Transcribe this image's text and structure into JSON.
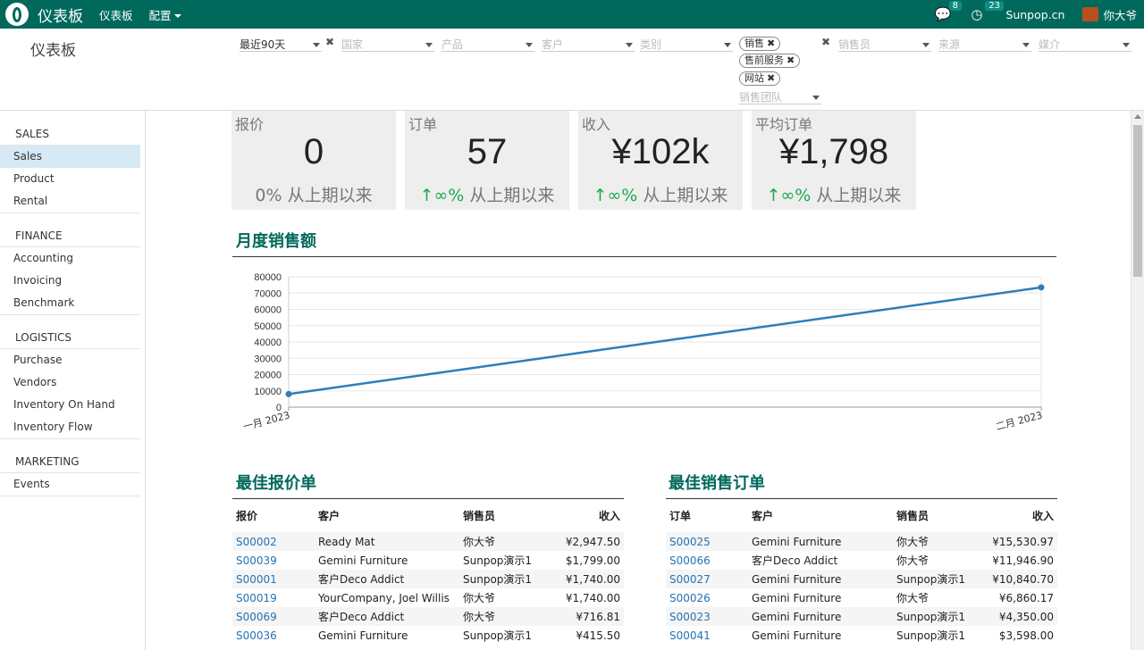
{
  "navbar": {
    "app_name": "仪表板",
    "menu_dashboard": "仪表板",
    "menu_config": "配置",
    "messages_count": "8",
    "activities_count": "23",
    "company": "Sunpop.cn",
    "user": "你大爷"
  },
  "control": {
    "title": "仪表板",
    "date_filter": "最近90天",
    "country_placeholder": "国家",
    "product_placeholder": "产品",
    "customer_placeholder": "客户",
    "category_placeholder": "类别",
    "team_chips": [
      "销售",
      "售前服务",
      "网站"
    ],
    "sales_team_placeholder": "销售团队",
    "salesperson_placeholder": "销售员",
    "source_placeholder": "来源",
    "medium_placeholder": "媒介"
  },
  "sidebar": {
    "sections": [
      {
        "title": "SALES",
        "items": [
          "Sales",
          "Product",
          "Rental"
        ]
      },
      {
        "title": "FINANCE",
        "items": [
          "Accounting",
          "Invoicing",
          "Benchmark"
        ]
      },
      {
        "title": "LOGISTICS",
        "items": [
          "Purchase",
          "Vendors",
          "Inventory On Hand",
          "Inventory Flow"
        ]
      },
      {
        "title": "MARKETING",
        "items": [
          "Events"
        ]
      }
    ]
  },
  "kpis": [
    {
      "label": "报价",
      "value": "0",
      "trend_arrow": "",
      "trend_value": "0%",
      "trend_text": "从上期以来"
    },
    {
      "label": "订单",
      "value": "57",
      "trend_arrow": "↑",
      "trend_value": "∞%",
      "trend_text": "从上期以来"
    },
    {
      "label": "收入",
      "value": "¥102k",
      "trend_arrow": "↑",
      "trend_value": "∞%",
      "trend_text": "从上期以来"
    },
    {
      "label": "平均订单",
      "value": "¥1,798",
      "trend_arrow": "↑",
      "trend_value": "∞%",
      "trend_text": "从上期以来"
    }
  ],
  "monthly_sales": {
    "title": "月度销售额"
  },
  "chart_data": {
    "type": "line",
    "title": "月度销售额",
    "x": [
      "一月 2023",
      "二月 2023"
    ],
    "series": [
      {
        "values": [
          8000,
          73500
        ]
      }
    ],
    "yticks": [
      0,
      10000,
      20000,
      30000,
      40000,
      50000,
      60000,
      70000,
      80000
    ],
    "ylim": [
      0,
      80000
    ],
    "grid": true,
    "color": "#2e7db8"
  },
  "best_quotations": {
    "title": "最佳报价单",
    "headers": [
      "报价",
      "客户",
      "销售员",
      "收入"
    ],
    "rows": [
      [
        "S00002",
        "Ready Mat",
        "你大爷",
        "¥2,947.50"
      ],
      [
        "S00039",
        "Gemini Furniture",
        "Sunpop演示1",
        "$1,799.00"
      ],
      [
        "S00001",
        "客户Deco Addict",
        "Sunpop演示1",
        "¥1,740.00"
      ],
      [
        "S00019",
        "YourCompany, Joel Willis",
        "你大爷",
        "¥1,740.00"
      ],
      [
        "S00069",
        "客户Deco Addict",
        "你大爷",
        "¥716.81"
      ],
      [
        "S00036",
        "Gemini Furniture",
        "Sunpop演示1",
        "¥415.50"
      ]
    ]
  },
  "best_orders": {
    "title": "最佳销售订单",
    "headers": [
      "订单",
      "客户",
      "销售员",
      "收入"
    ],
    "rows": [
      [
        "S00025",
        "Gemini Furniture",
        "你大爷",
        "¥15,530.97"
      ],
      [
        "S00066",
        "客户Deco Addict",
        "你大爷",
        "¥11,946.90"
      ],
      [
        "S00027",
        "Gemini Furniture",
        "Sunpop演示1",
        "¥10,840.70"
      ],
      [
        "S00026",
        "Gemini Furniture",
        "你大爷",
        "¥6,860.17"
      ],
      [
        "S00023",
        "Gemini Furniture",
        "Sunpop演示1",
        "¥4,350.00"
      ],
      [
        "S00041",
        "Gemini Furniture",
        "Sunpop演示1",
        "$3,598.00"
      ]
    ]
  }
}
